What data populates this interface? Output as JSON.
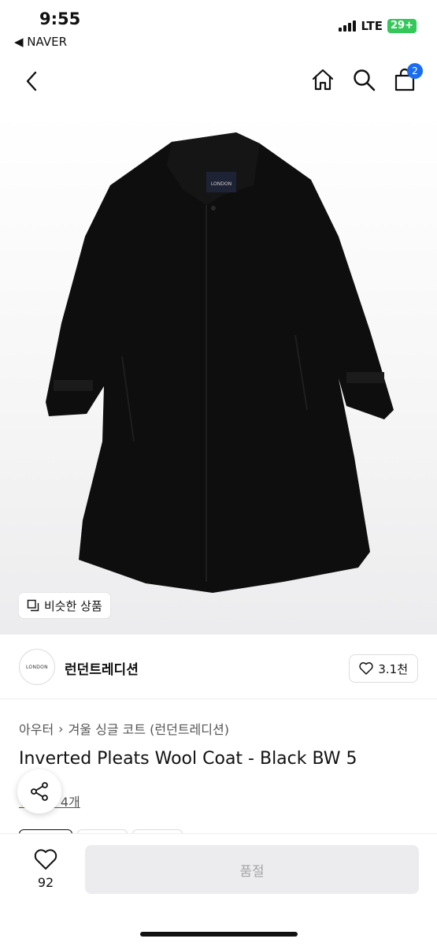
{
  "status_bar": {
    "time": "9:55",
    "back_app": "◀ NAVER",
    "network": "LTE",
    "battery": "29+"
  },
  "nav": {
    "cart_count": "2",
    "icons": [
      "chevron-left-icon",
      "home-icon",
      "search-icon",
      "shopping-bag-icon"
    ]
  },
  "hero": {
    "similar_label": "비슷한 상품",
    "coat_label": "LONDON"
  },
  "brand": {
    "logo_text": "LONDON",
    "name": "런던트레디션",
    "likes": "3.1천"
  },
  "product": {
    "breadcrumb": [
      "아우터",
      "겨울 싱글 코트 (런던트레디션)"
    ],
    "title": "Inverted Pleats Wool Coat - Black BW 5",
    "review_link": "후기 4개"
  },
  "bottom_bar": {
    "wish_count": "92",
    "purchase_label": "품절"
  },
  "colors": {
    "accent": "#1a6cf0",
    "disabled_bg": "#ececee",
    "disabled_text": "#a5a5a8",
    "battery": "#34c759"
  }
}
